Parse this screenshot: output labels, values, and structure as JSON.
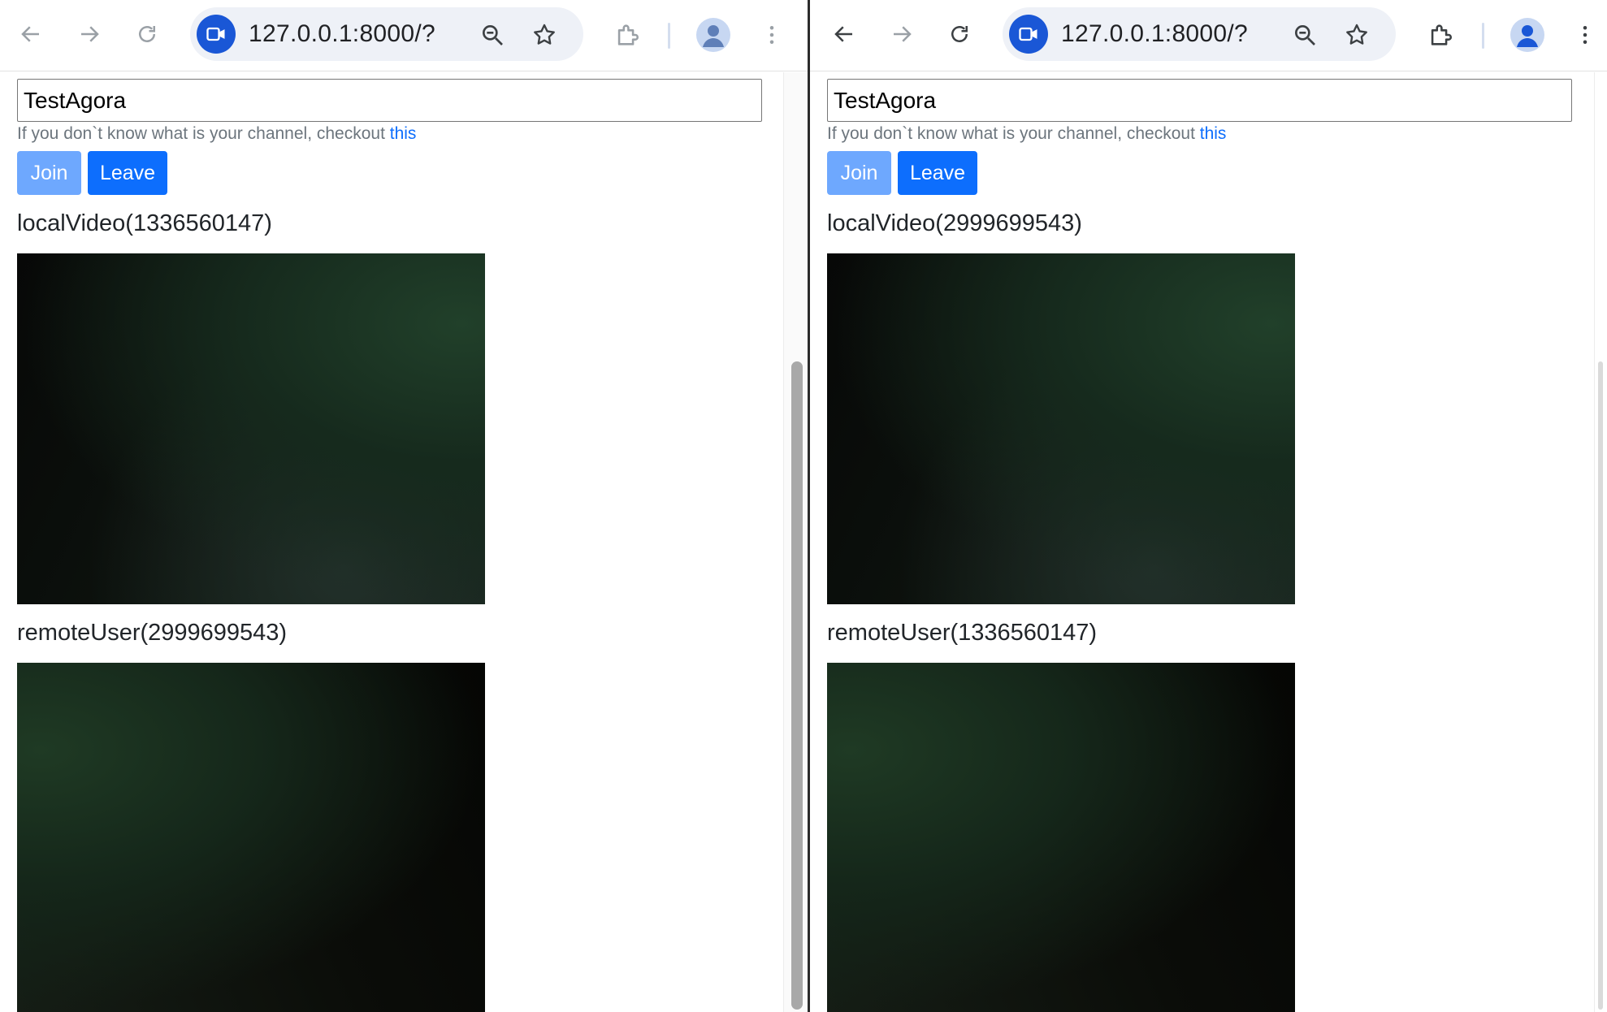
{
  "left": {
    "url": "127.0.0.1:8000/?",
    "channel_value": "TestAgora",
    "helper_text": "If you don`t know what is your channel, checkout ",
    "helper_link": "this",
    "join_label": "Join",
    "leave_label": "Leave",
    "local_label": "localVideo(1336560147)",
    "remote_label": "remoteUser(2999699543)"
  },
  "right": {
    "url": "127.0.0.1:8000/?",
    "channel_value": "TestAgora",
    "helper_text": "If you don`t know what is your channel, checkout ",
    "helper_link": "this",
    "join_label": "Join",
    "leave_label": "Leave",
    "local_label": "localVideo(2999699543)",
    "remote_label": "remoteUser(1336560147)"
  },
  "colors": {
    "primary": "#0d6efd",
    "primary_disabled": "#6ea8fe",
    "site_badge": "#1a57d6",
    "omnibox_bg": "#eef1f7",
    "muted_text": "#6c757d"
  },
  "icons": [
    "back-arrow-icon",
    "forward-arrow-icon",
    "reload-icon",
    "camera-icon",
    "zoom-icon",
    "star-icon",
    "extension-icon",
    "profile-icon",
    "kebab-menu-icon"
  ]
}
